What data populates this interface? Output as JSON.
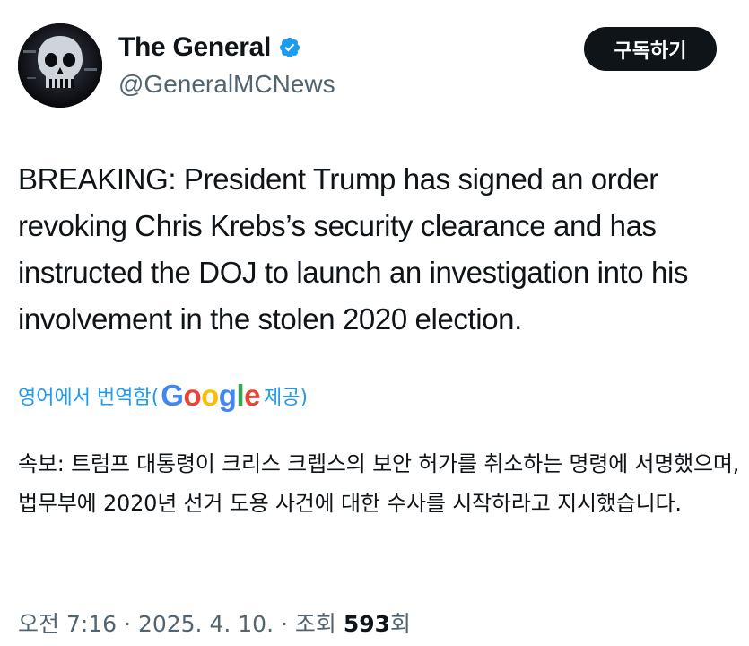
{
  "author": {
    "display_name": "The General",
    "handle": "@GeneralMCNews",
    "verified": true,
    "verified_color": "#1d9bf0",
    "avatar_icon": "punisher-skull-icon"
  },
  "subscribe_button": {
    "label": "구독하기"
  },
  "tweet": {
    "text": "BREAKING: President Trump has signed an order revoking Chris Krebs’s security clearance and has instructed the DOJ to launch an investigation into his involvement in the stolen 2020 election."
  },
  "translation": {
    "prefix": "영어에서 번역함(",
    "brand": "Google",
    "suffix": " 제공)",
    "text": "속보: 트럼프 대통령이 크리스 크렙스의 보안 허가를 취소하는 명령에 서명했으며, 법무부에 2020년 선거 도용 사건에 대한 수사를 시작하라고 지시했습니다."
  },
  "meta": {
    "time": "오전 7:16",
    "separator1": " · ",
    "date": "2025. 4. 10.",
    "separator2": " · ",
    "views_label": "조회 ",
    "views_count": "593",
    "views_suffix": "회"
  }
}
